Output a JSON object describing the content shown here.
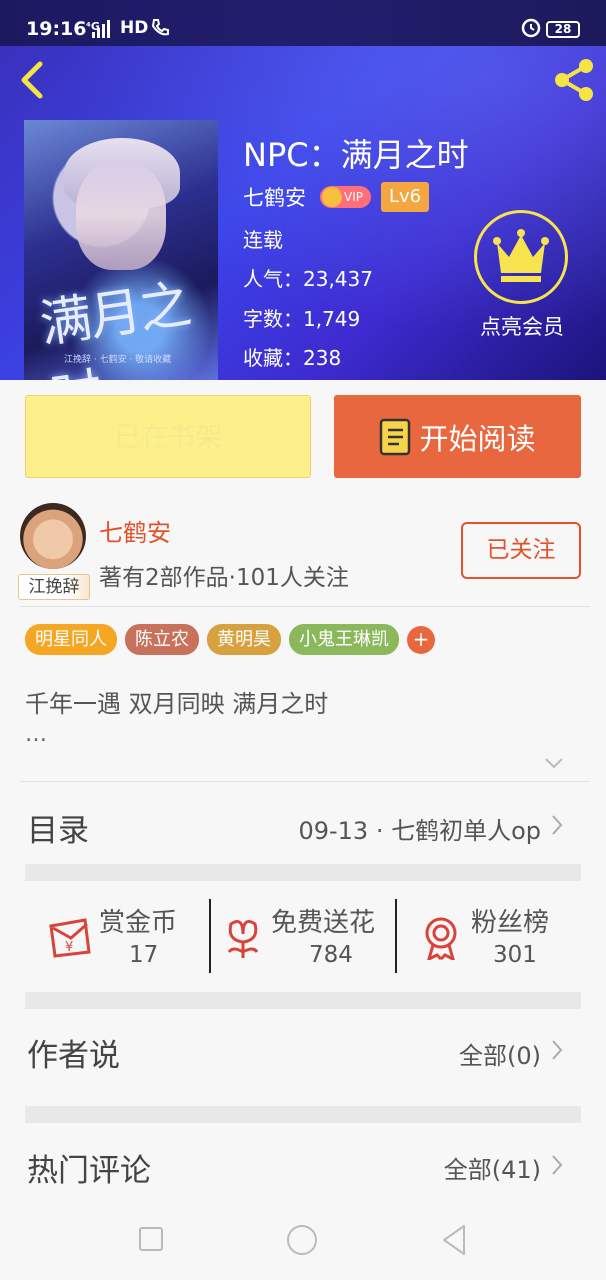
{
  "status_bar": {
    "time": "19:16",
    "network": "⁴G",
    "hd": "HD",
    "battery": "28"
  },
  "book": {
    "title": "NPC：满月之时",
    "author": "七鹤安",
    "vip_badge": "VIP",
    "level": "Lv6",
    "status": "连载",
    "popularity_label": "人气：",
    "popularity": "23,437",
    "words_label": "字数：",
    "words": "1,749",
    "favorites_label": "收藏：",
    "favorites": "238",
    "cover_title": "满月之时",
    "cover_subtitle": "江挽辞 · 七鹤安 · 敬请收藏"
  },
  "vip_promo": {
    "label": "点亮会员"
  },
  "actions": {
    "shelf_label": "已在书架",
    "read_label": "开始阅读"
  },
  "author_card": {
    "name": "七鹤安",
    "tag": "江挽辞",
    "description": "著有2部作品·101人关注",
    "follow_label": "已关注"
  },
  "tags": [
    {
      "label": "明星同人",
      "color": "#f5a623"
    },
    {
      "label": "陈立农",
      "color": "#c8715b"
    },
    {
      "label": "黄明昊",
      "color": "#d7a13f"
    },
    {
      "label": "小鬼王琳凯",
      "color": "#8bb85a"
    }
  ],
  "tag_more": "+",
  "intro": {
    "text": "千年一遇 双月同映 满月之时",
    "more": "…"
  },
  "catalog": {
    "label": "目录",
    "latest": "09-13 · 七鹤初单人op"
  },
  "stats": [
    {
      "label": "赏金币",
      "value": "17",
      "icon": "red-envelope-icon"
    },
    {
      "label": "免费送花",
      "value": "784",
      "icon": "flower-icon"
    },
    {
      "label": "粉丝榜",
      "value": "301",
      "icon": "medal-icon"
    }
  ],
  "author_notes": {
    "label": "作者说",
    "value": "全部(0)"
  },
  "hot_comments": {
    "label": "热门评论",
    "value": "全部(41)"
  },
  "colors": {
    "accent": "#e9673f",
    "link": "#e2522b",
    "vip_gold": "#f7e34d",
    "hero_blue": "#3b43e8"
  }
}
